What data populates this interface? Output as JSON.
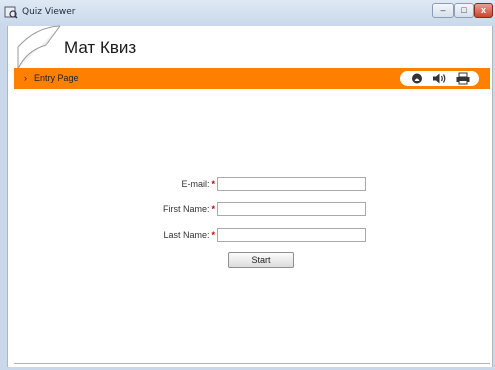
{
  "window": {
    "title": "Quiz Viewer",
    "controls": {
      "minimize": "–",
      "maximize": "□",
      "close": "x"
    }
  },
  "header": {
    "quiz_title": "Мат Квиз"
  },
  "nav": {
    "page_label": "Entry Page",
    "arrow": "›",
    "tools": [
      {
        "icon": "help-icon"
      },
      {
        "icon": "sound-icon"
      },
      {
        "icon": "print-icon"
      }
    ]
  },
  "form": {
    "fields": [
      {
        "label": "E-mail:",
        "required_mark": "*",
        "value": ""
      },
      {
        "label": "First Name:",
        "required_mark": "*",
        "value": ""
      },
      {
        "label": "Last Name:",
        "required_mark": "*",
        "value": ""
      }
    ],
    "start_label": "Start"
  },
  "colors": {
    "accent": "#ff7f00",
    "required": "#cc0000"
  }
}
